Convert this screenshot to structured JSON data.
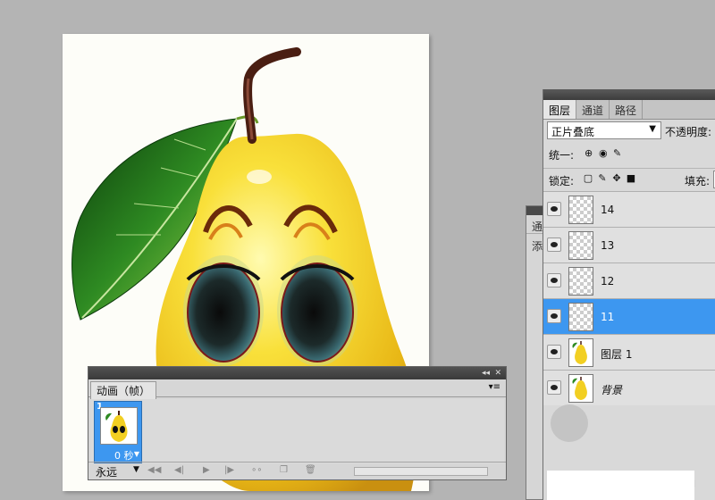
{
  "canvas": {
    "description_icon": "pear-artwork"
  },
  "back_panel": {
    "tab_partial": "通",
    "row_partial": "添"
  },
  "layers_panel": {
    "tabs": [
      {
        "label": "图层",
        "active": true
      },
      {
        "label": "通道",
        "active": false
      },
      {
        "label": "路径",
        "active": false
      }
    ],
    "blend_mode": "正片叠底",
    "opacity_label": "不透明度:",
    "unify_label": "统一:",
    "lock_label": "锁定:",
    "fill_label": "填充:",
    "layers": [
      {
        "name": "14",
        "selected": false,
        "visible": true,
        "thumb": "transparent"
      },
      {
        "name": "13",
        "selected": false,
        "visible": true,
        "thumb": "transparent"
      },
      {
        "name": "12",
        "selected": false,
        "visible": true,
        "thumb": "transparent"
      },
      {
        "name": "11",
        "selected": true,
        "visible": true,
        "thumb": "transparent"
      },
      {
        "name": "图层 1",
        "selected": false,
        "visible": true,
        "thumb": "pear"
      },
      {
        "name": "背景",
        "selected": false,
        "visible": true,
        "thumb": "pear",
        "italic": true
      }
    ]
  },
  "animation_panel": {
    "title": "动画（帧）",
    "frame": {
      "number": "1",
      "time": "0 秒"
    },
    "loop": "永远"
  },
  "colors": {
    "selection_blue": "#3d97f0",
    "panel_gray": "#d9d9d9",
    "workspace_gray": "#b4b4b4"
  }
}
